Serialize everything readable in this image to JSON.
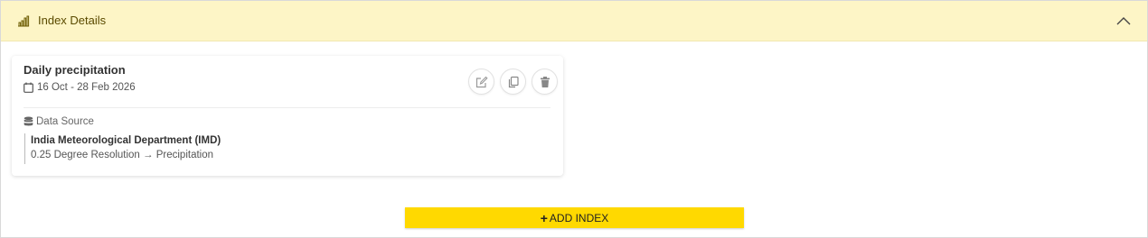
{
  "header": {
    "title": "Index Details",
    "icon": "bar-chart-icon",
    "collapse_icon": "chevron-up-icon",
    "background": "#fdf5c6"
  },
  "index_card": {
    "title": "Daily precipitation",
    "date_range": "16 Oct - 28 Feb 2026",
    "actions": [
      {
        "icon": "edit-icon"
      },
      {
        "icon": "copy-icon"
      },
      {
        "icon": "delete-icon"
      }
    ],
    "data_source_label": "Data Source",
    "data_source_name": "India Meteorological Department (IMD)",
    "data_source_detail": "0.25 Degree Resolution → Precipitation"
  },
  "add_button": {
    "icon": "plus-icon",
    "label": "ADD INDEX",
    "color": "#ffd900"
  }
}
